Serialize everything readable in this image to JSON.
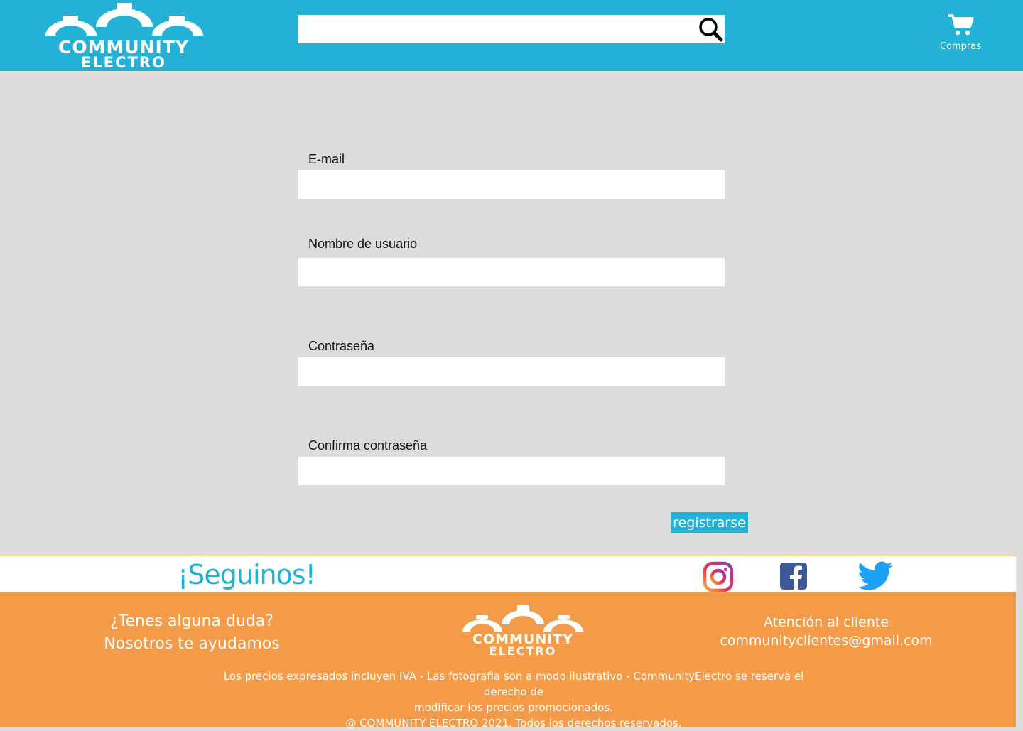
{
  "header": {
    "logo": {
      "line1": "COMMUNITY",
      "line2": "ELECTRO"
    },
    "search": {
      "value": "",
      "placeholder": ""
    },
    "search_icon": "search-icon",
    "cart": {
      "icon": "cart-icon",
      "label": "Compras"
    }
  },
  "form": {
    "email": {
      "label": "E-mail",
      "value": ""
    },
    "username": {
      "label": "Nombre de usuario",
      "value": ""
    },
    "password": {
      "label": "Contraseña",
      "value": ""
    },
    "confirm_password": {
      "label": "Confirma contraseña",
      "value": ""
    },
    "submit_label": "registrarse"
  },
  "follow": {
    "title": "¡Seguinos!",
    "networks": [
      "instagram-icon",
      "facebook-icon",
      "twitter-icon"
    ]
  },
  "footer": {
    "help_line1": "¿Tenes alguna duda?",
    "help_line2": "Nosotros te ayudamos",
    "logo": {
      "line1": "COMMUNITY",
      "line2": "ELECTRO"
    },
    "contact_title": "Atención al cliente",
    "contact_email": "communityclientes@gmail.com",
    "legal_line1": "Los precios expresados incluyen IVA - Las fotografia son a modo ilustrativo - CommunityElectro se reserva el derecho de",
    "legal_line2": "modificar los precios promocionados.",
    "legal_line3": "@ COMMUNITY ELECTRO 2021. Todos los derechos reservados."
  },
  "colors": {
    "header_bg": "#23b2d5",
    "page_bg": "#dcdcdc",
    "footer_bg": "#f49b49",
    "accent": "#23b2d5"
  }
}
